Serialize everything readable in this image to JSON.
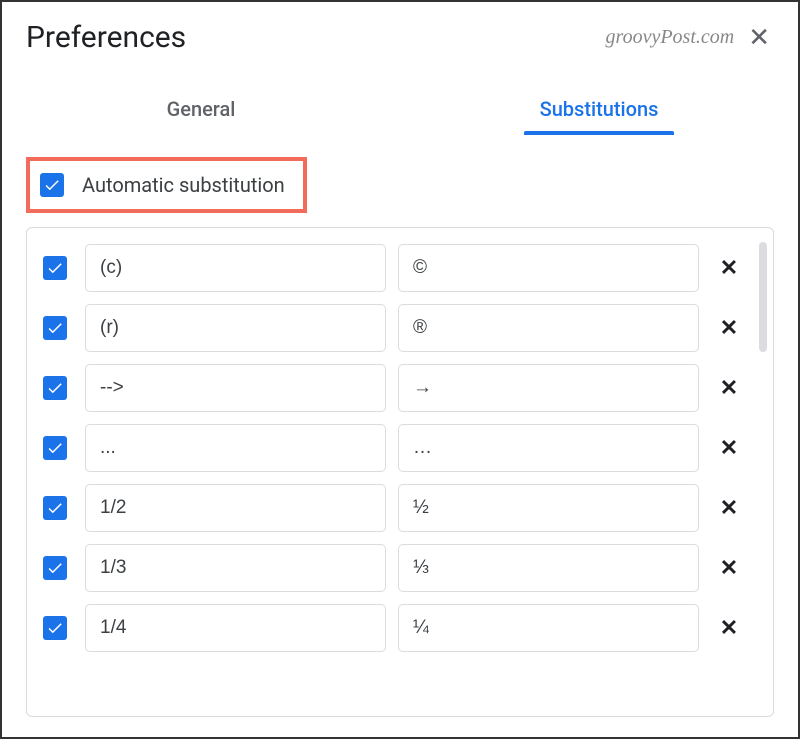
{
  "dialog": {
    "title": "Preferences",
    "watermark": "groovyPost.com"
  },
  "tabs": {
    "general": "General",
    "substitutions": "Substitutions",
    "active": "substitutions"
  },
  "autoSubstitution": {
    "label": "Automatic substitution",
    "checked": true
  },
  "substitutions": [
    {
      "checked": true,
      "replace": "(c)",
      "with": "©"
    },
    {
      "checked": true,
      "replace": "(r)",
      "with": "®"
    },
    {
      "checked": true,
      "replace": "-->",
      "with": "→"
    },
    {
      "checked": true,
      "replace": "...",
      "with": "…"
    },
    {
      "checked": true,
      "replace": "1/2",
      "with": "½"
    },
    {
      "checked": true,
      "replace": "1/3",
      "with": "⅓"
    },
    {
      "checked": true,
      "replace": "1/4",
      "with": "¼"
    }
  ]
}
